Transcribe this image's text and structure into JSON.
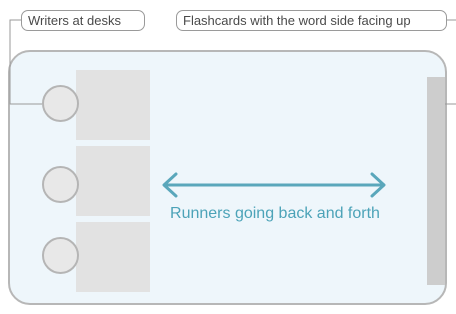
{
  "labels": {
    "writers": "Writers at desks",
    "flashcards": "Flashcards with the word side facing up",
    "runners": "Runners going back and forth"
  },
  "colors": {
    "arrow": "#5aa7bb",
    "room_fill": "#eef6fb",
    "room_border": "#b7b7b7",
    "desk": "#e2e2e2",
    "leader_line": "#9a9a9a"
  },
  "counts": {
    "desks": 3
  }
}
